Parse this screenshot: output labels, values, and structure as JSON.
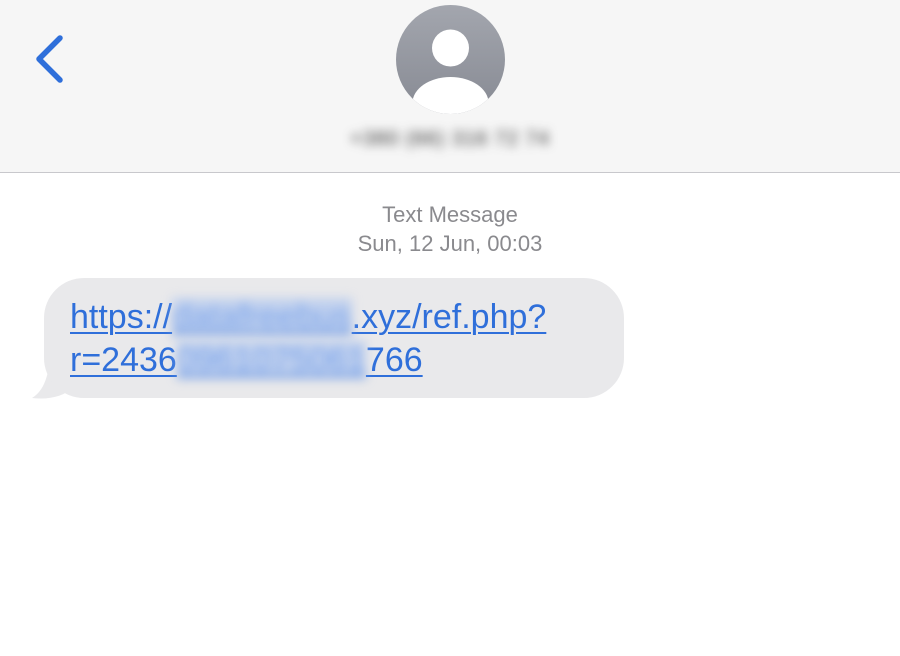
{
  "header": {
    "back_label": "Back",
    "contact_name": "+380 (66) 316 72 74"
  },
  "conversation": {
    "service_label": "Text Message",
    "date_label": "Sun, 12 Jun,",
    "time_label": "00:03"
  },
  "message": {
    "link_line1_start": "https://",
    "link_line1_blur": "datafreebus",
    "link_line1_end": ".xyz/ref.php?",
    "link_line2_start": "r=2436",
    "link_line2_blur": "0961075061",
    "link_line2_end": "766"
  },
  "colors": {
    "accent": "#2f6fda",
    "bubble": "#e9e9eb",
    "header_bg": "#f6f6f6",
    "meta_text": "#8a8a8e"
  },
  "icons": {
    "back": "chevron-left-icon",
    "avatar": "person-silhouette-icon"
  }
}
